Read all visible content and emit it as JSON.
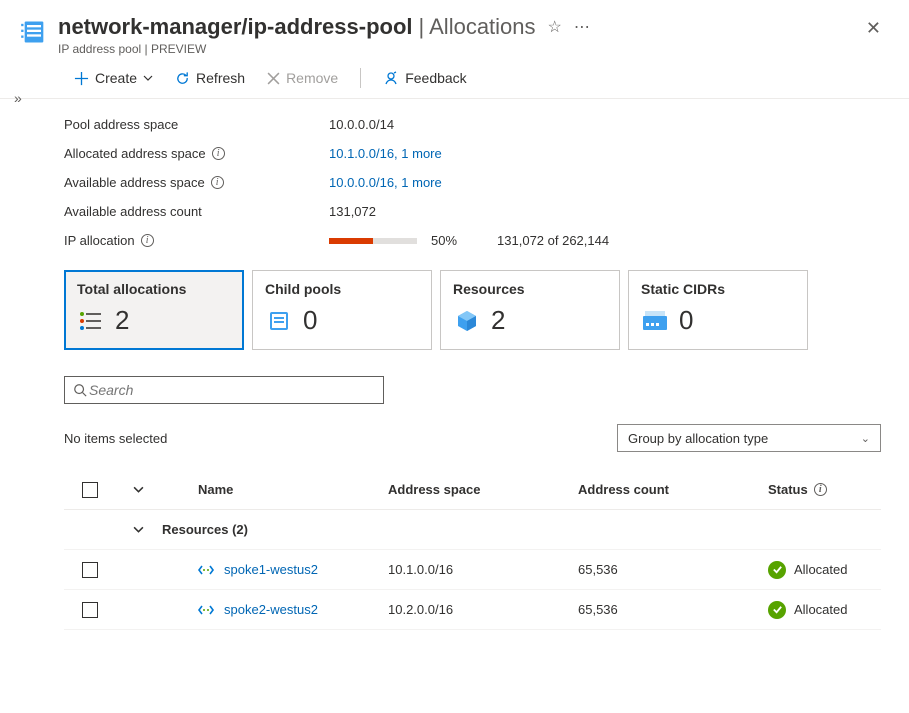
{
  "header": {
    "title_main": "network-manager/ip-address-pool",
    "title_suffix": " | Allocations",
    "subtitle": "IP address pool | PREVIEW"
  },
  "toolbar": {
    "create": "Create",
    "refresh": "Refresh",
    "remove": "Remove",
    "feedback": "Feedback"
  },
  "properties": {
    "pool_space_label": "Pool address space",
    "pool_space_value": "10.0.0.0/14",
    "allocated_label": "Allocated address space",
    "allocated_value": "10.1.0.0/16, 1 more",
    "available_label": "Available address space",
    "available_value": "10.0.0.0/16, 1 more",
    "count_label": "Available address count",
    "count_value": "131,072",
    "ip_alloc_label": "IP allocation",
    "percent": "50%",
    "progress_percent": 50,
    "alloc_count": "131,072 of 262,144"
  },
  "cards": {
    "total": {
      "title": "Total allocations",
      "value": "2"
    },
    "child": {
      "title": "Child pools",
      "value": "0"
    },
    "resources": {
      "title": "Resources",
      "value": "2"
    },
    "static": {
      "title": "Static CIDRs",
      "value": "0"
    }
  },
  "search": {
    "placeholder": "Search"
  },
  "selection": {
    "none_text": "No items selected",
    "group_by": "Group by allocation type"
  },
  "table": {
    "col_name": "Name",
    "col_space": "Address space",
    "col_count": "Address count",
    "col_status": "Status",
    "group_label": "Resources (2)",
    "rows": [
      {
        "name": "spoke1-westus2",
        "space": "10.1.0.0/16",
        "count": "65,536",
        "status": "Allocated"
      },
      {
        "name": "spoke2-westus2",
        "space": "10.2.0.0/16",
        "count": "65,536",
        "status": "Allocated"
      }
    ]
  }
}
